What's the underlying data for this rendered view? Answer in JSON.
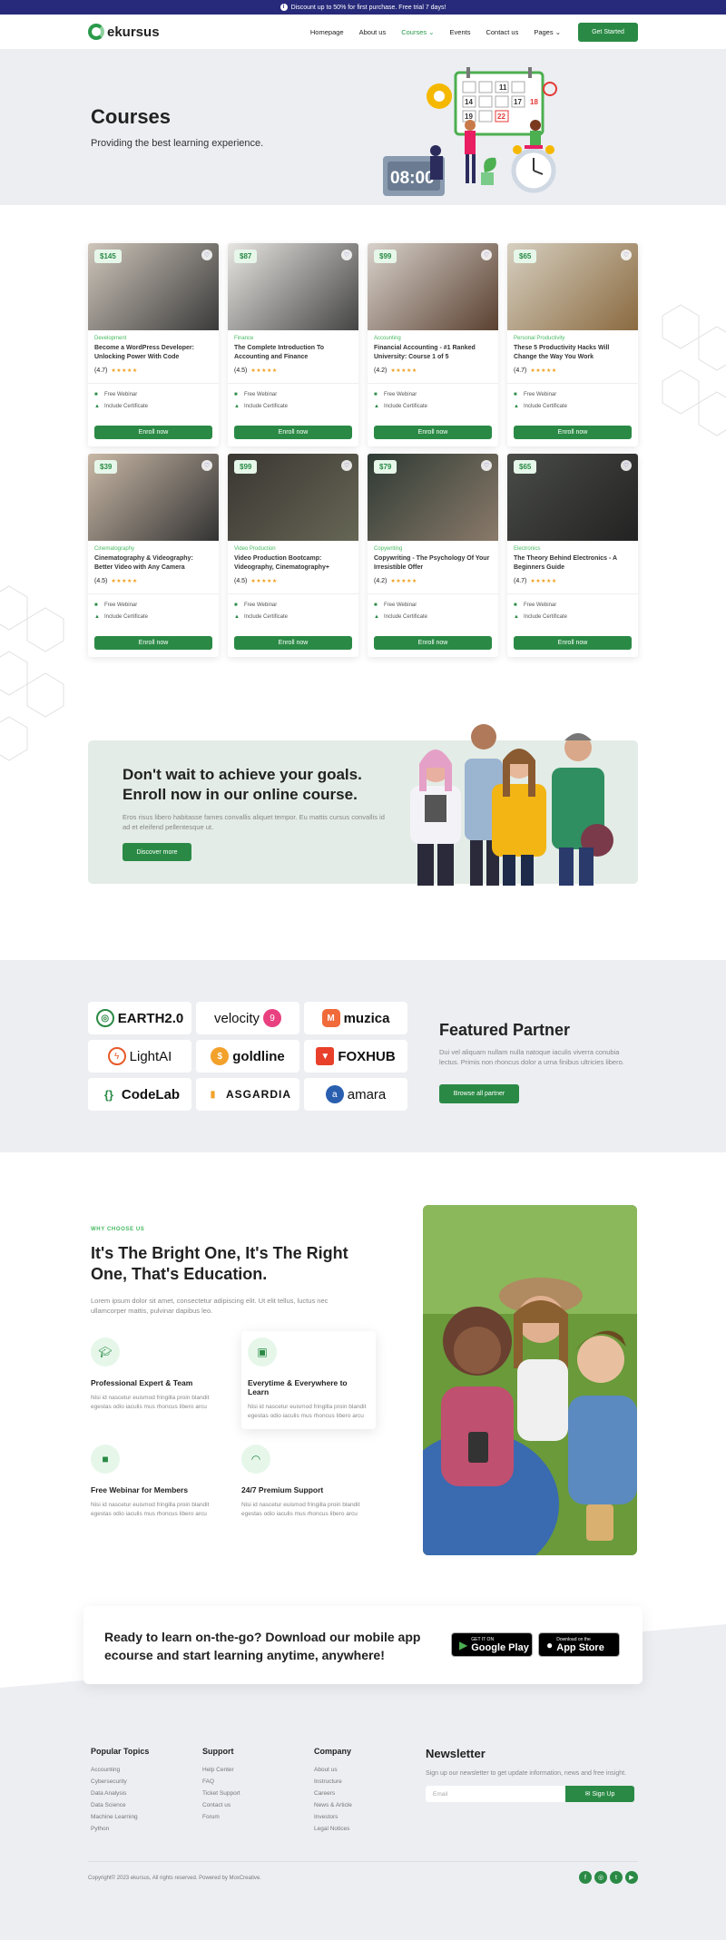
{
  "promo": "Discount up to 50% for first purchase. Free trial 7 days!",
  "brand": "ekursus",
  "nav": {
    "items": [
      "Homepage",
      "About us",
      "Courses",
      "Events",
      "Contact us",
      "Pages"
    ],
    "cta": "Get Started"
  },
  "hero": {
    "title": "Courses",
    "subtitle": "Providing the best learning experience.",
    "clock": "08:00",
    "calendar": [
      "11",
      "14",
      "17",
      "18",
      "19",
      "22"
    ]
  },
  "courses": [
    {
      "price": "$145",
      "category": "Development",
      "title": "Become a WordPress Developer: Unlocking Power With Code",
      "rating": "(4.7)"
    },
    {
      "price": "$87",
      "category": "Finance",
      "title": "The Complete Introduction To Accounting and Finance",
      "rating": "(4.5)"
    },
    {
      "price": "$99",
      "category": "Accounting",
      "title": "Financial Accounting - #1 Ranked University: Course 1 of 5",
      "rating": "(4.2)"
    },
    {
      "price": "$65",
      "category": "Personal Productivity",
      "title": "These 5 Productivity Hacks Will Change the Way You Work",
      "rating": "(4.7)"
    },
    {
      "price": "$39",
      "category": "Cinematography",
      "title": "Cinematography & Videography: Better Video with Any Camera",
      "rating": "(4.5)"
    },
    {
      "price": "$99",
      "category": "Video Production",
      "title": "Video Production Bootcamp: Videography, Cinematography+",
      "rating": "(4.5)"
    },
    {
      "price": "$79",
      "category": "Copywriting",
      "title": "Copywriting - The Psychology Of Your Irresistible Offer",
      "rating": "(4.2)"
    },
    {
      "price": "$65",
      "category": "Electronics",
      "title": "The Theory Behind Electronics - A Beginners Guide",
      "rating": "(4.7)"
    }
  ],
  "course_card": {
    "feature1": "Free Webinar",
    "feature2": "Include Certificate",
    "button": "Enroll now",
    "stars": "★★★★★"
  },
  "cta": {
    "title": "Don't wait to achieve your goals. Enroll now in our online course.",
    "text": "Eros risus libero habitasse fames convallis aliquet tempor. Eu mattis cursus convallis id ad et eleifend pellentesque ut.",
    "button": "Discover more"
  },
  "partners": {
    "logos": [
      "EARTH2.0",
      "velocity",
      "muzica",
      "LightAI",
      "goldline",
      "FOXHUB",
      "CodeLab",
      "ASGARDIA",
      "amara"
    ],
    "title": "Featured Partner",
    "text": "Dui vel aliquam nullam nulla natoque iaculis viverra conubia lectus. Primis non rhoncus dolor a urna finibus ultricies libero.",
    "button": "Browse all partner"
  },
  "why": {
    "kicker": "WHY CHOOSE US",
    "title": "It's The Bright One, It's The Right One, That's Education.",
    "lead": "Lorem ipsum dolor sit amet, consectetur adipiscing elit. Ut elit tellus, luctus nec ullamcorper mattis, pulvinar dapibus leo.",
    "features": [
      {
        "title": "Professional Expert & Team",
        "text": "Nisi id nascetur euismod fringilla proin blandit egestas odio iaculis mus rhoncus libero arcu"
      },
      {
        "title": "Everytime & Everywhere to Learn",
        "text": "Nisi id nascetur euismod fringilla proin blandit egestas odio iaculis mus rhoncus libero arcu"
      },
      {
        "title": "Free Webinar for Members",
        "text": "Nisi id nascetur euismod fringilla proin blandit egestas odio iaculis mus rhoncus libero arcu"
      },
      {
        "title": "24/7 Premium Support",
        "text": "Nisi id nascetur euismod fringilla proin blandit egestas odio iaculis mus rhoncus libero arcu"
      }
    ]
  },
  "app": {
    "title": "Ready to learn on-the-go? Download our mobile app ecourse and start learning anytime, anywhere!",
    "google_small": "GET IT ON",
    "google_big": "Google Play",
    "apple_small": "Download on the",
    "apple_big": "App Store"
  },
  "footer": {
    "popular": {
      "title": "Popular Topics",
      "links": [
        "Accounting",
        "Cybersecurity",
        "Data Analysis",
        "Data Science",
        "Machine Learning",
        "Python"
      ]
    },
    "support": {
      "title": "Support",
      "links": [
        "Help Center",
        "FAQ",
        "Ticket Support",
        "Contact us",
        "Forum"
      ]
    },
    "company": {
      "title": "Company",
      "links": [
        "About us",
        "Instructure",
        "Careers",
        "News & Article",
        "Investors",
        "Legal Notices"
      ]
    },
    "newsletter": {
      "title": "Newsletter",
      "text": "Sign up our newsletter to get update information, news and free insight.",
      "placeholder": "Email",
      "button": "Sign Up"
    },
    "copyright": "Copyright© 2023 ekursus, All rights reserved. Powered by MoxCreative."
  },
  "colors": {
    "primary": "#2a8a45",
    "accent_light": "#46b95f",
    "topbar": "#272a7a"
  }
}
